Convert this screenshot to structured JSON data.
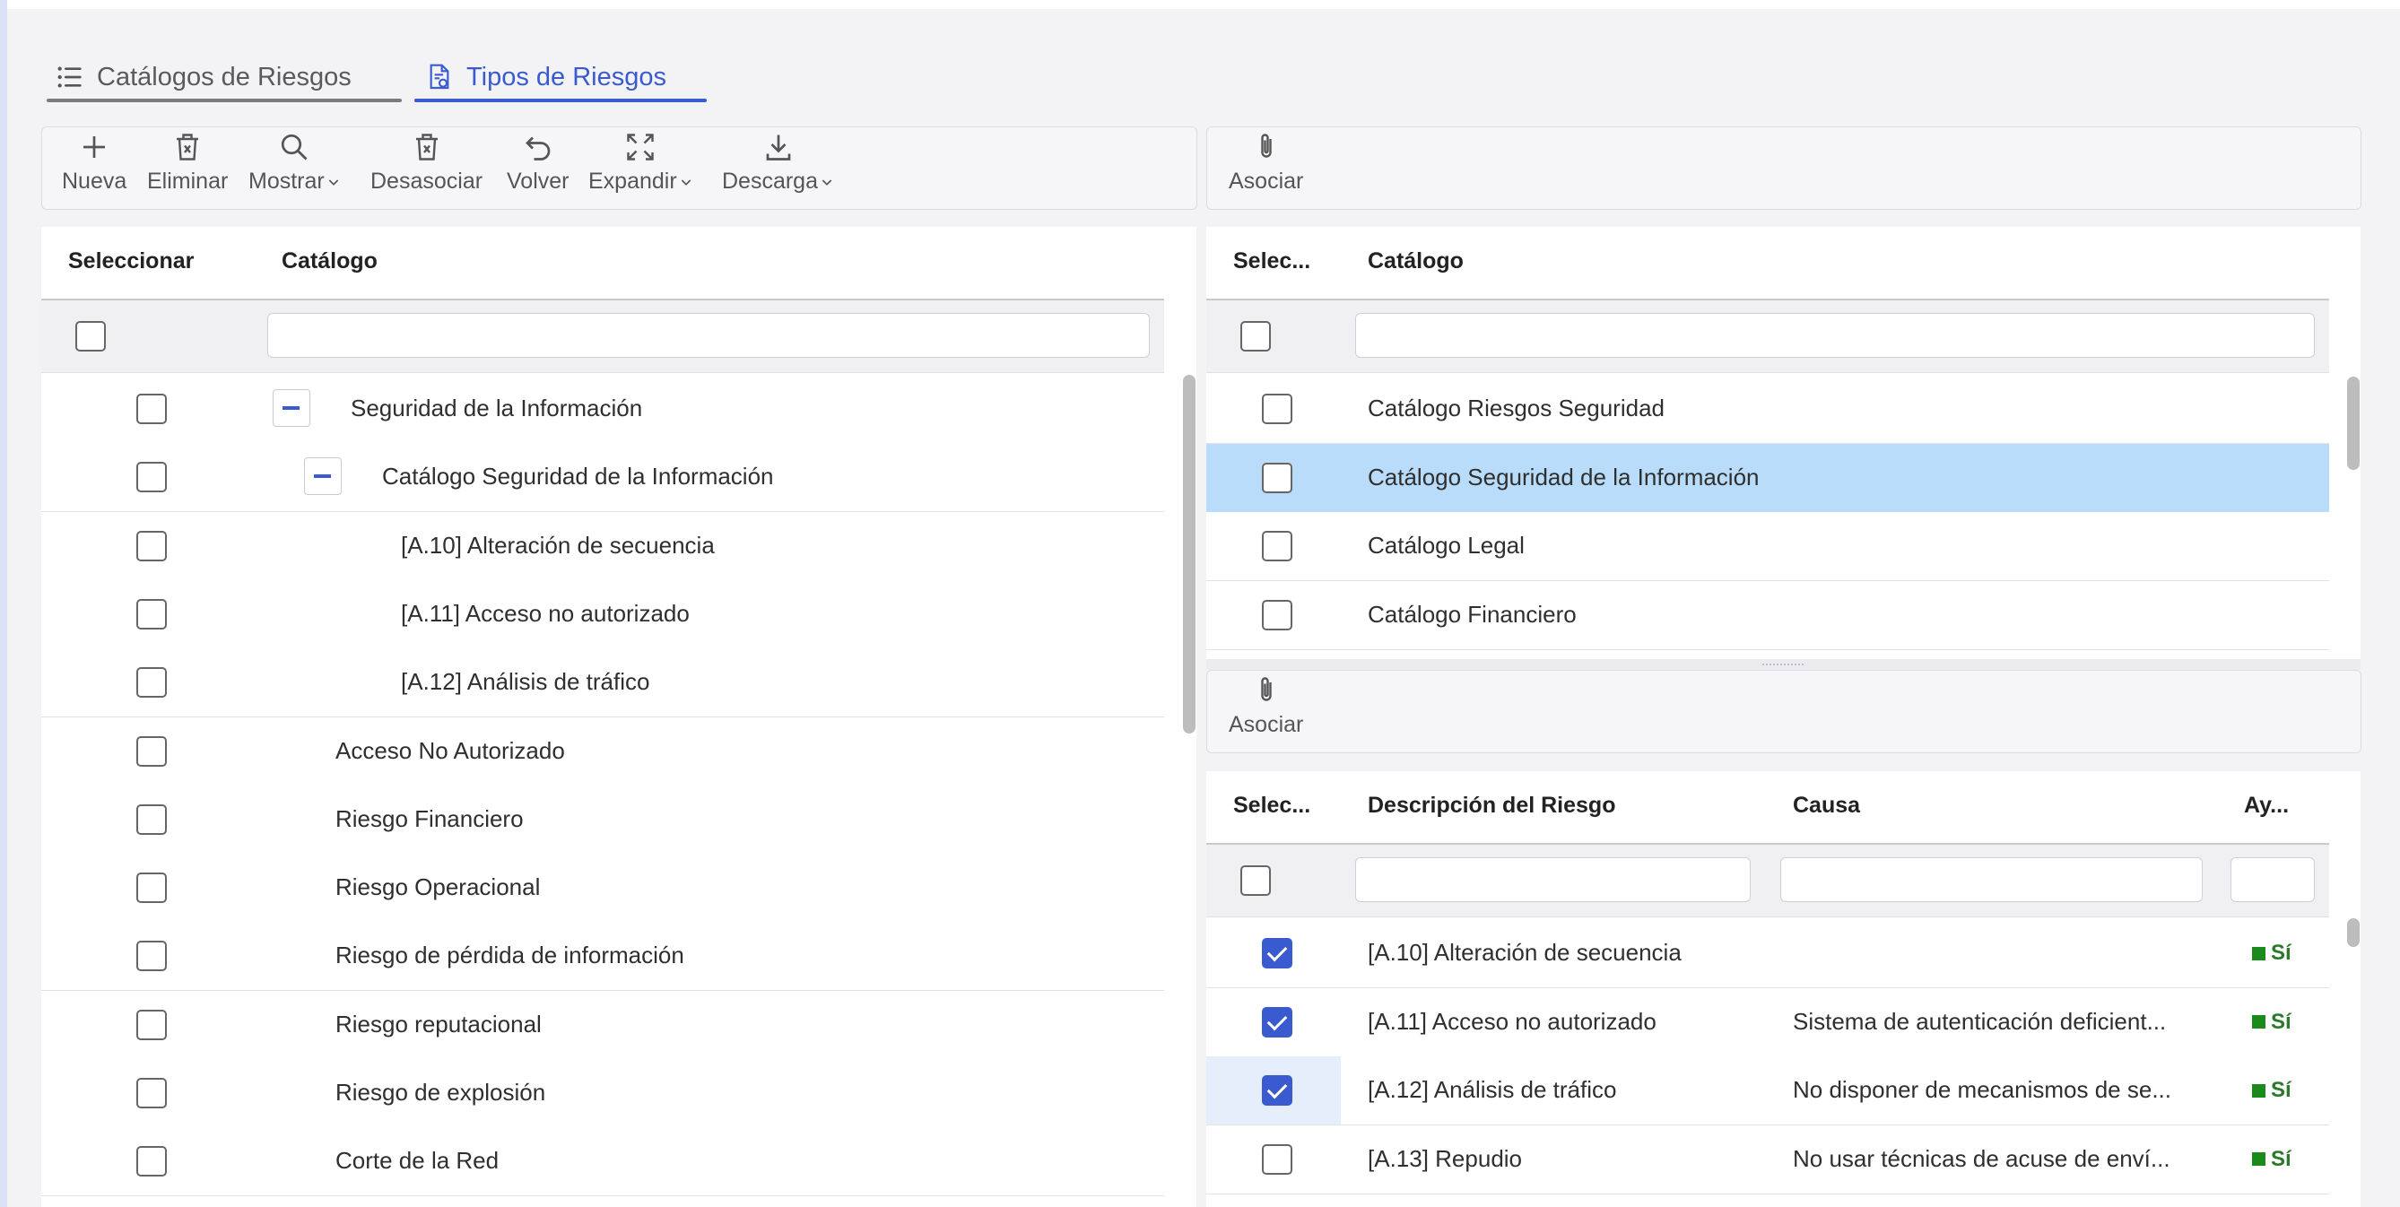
{
  "tabs": [
    {
      "label": "Catálogos de Riesgos",
      "icon": "list-icon",
      "active": false
    },
    {
      "label": "Tipos de Riesgos",
      "icon": "document-settings-icon",
      "active": true
    }
  ],
  "left_toolbar": {
    "buttons": [
      {
        "label": "Nueva",
        "icon": "plus-icon"
      },
      {
        "label": "Eliminar",
        "icon": "trash-icon"
      },
      {
        "label": "Mostrar",
        "icon": "search-icon",
        "dropdown": true
      },
      {
        "label": "Desasociar",
        "icon": "trash-icon"
      },
      {
        "label": "Volver",
        "icon": "undo-icon"
      },
      {
        "label": "Expandir",
        "icon": "expand-icon",
        "dropdown": true
      },
      {
        "label": "Descarga",
        "icon": "download-icon",
        "dropdown": true
      }
    ]
  },
  "left_grid": {
    "columns": [
      "Seleccionar",
      "Catálogo"
    ],
    "filter_value": "",
    "rows": [
      {
        "label": "Seguridad de la Información",
        "level": 0,
        "expandable": true
      },
      {
        "label": "Catálogo Seguridad de la Información",
        "level": 1,
        "expandable": true
      },
      {
        "label": "[A.10] Alteración de secuencia",
        "level": 2
      },
      {
        "label": "[A.11] Acceso no autorizado",
        "level": 2
      },
      {
        "label": "[A.12] Análisis de tráfico",
        "level": 2
      },
      {
        "label": "Acceso No Autorizado",
        "level": -1
      },
      {
        "label": "Riesgo Financiero",
        "level": -1
      },
      {
        "label": "Riesgo Operacional",
        "level": -1
      },
      {
        "label": "Riesgo de pérdida de información",
        "level": -1
      },
      {
        "label": "Riesgo reputacional",
        "level": -1
      },
      {
        "label": "Riesgo de explosión",
        "level": -1
      },
      {
        "label": "Corte de la Red",
        "level": -1
      }
    ]
  },
  "right_top_toolbar": {
    "asociar_label": "Asociar",
    "icon": "paperclip-icon"
  },
  "catalog_grid": {
    "columns": [
      "Selec...",
      "Catálogo"
    ],
    "filter_value": "",
    "rows": [
      {
        "label": "Catálogo Riesgos Seguridad",
        "selected": false
      },
      {
        "label": "Catálogo Seguridad de la Información",
        "selected": true
      },
      {
        "label": "Catálogo Legal",
        "selected": false
      },
      {
        "label": "Catálogo Financiero",
        "selected": false
      }
    ]
  },
  "right_bottom_toolbar": {
    "asociar_label": "Asociar",
    "icon": "paperclip-icon"
  },
  "risk_grid": {
    "columns": [
      "Selec...",
      "Descripción del Riesgo",
      "Causa",
      "Ay..."
    ],
    "rows": [
      {
        "checked": true,
        "descripcion": "[A.10] Alteración de secuencia",
        "causa": "",
        "ayuda": "Sí"
      },
      {
        "checked": true,
        "descripcion": "[A.11] Acceso no autorizado",
        "causa": "Sistema de autenticación deficient...",
        "ayuda": "Sí"
      },
      {
        "checked": true,
        "descripcion": "[A.12] Análisis de tráfico",
        "causa": "No disponer de mecanismos de se...",
        "ayuda": "Sí"
      },
      {
        "checked": false,
        "descripcion": "[A.13] Repudio",
        "causa": "No usar técnicas de acuse de enví...",
        "ayuda": "Sí"
      }
    ],
    "colors": {
      "yes": "#1a8a1a",
      "check": "#3a5bd0"
    }
  }
}
